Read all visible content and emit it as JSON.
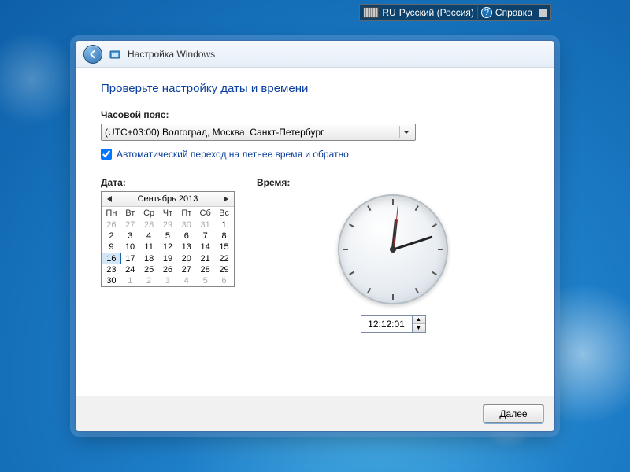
{
  "langbar": {
    "code": "RU",
    "language": "Русский (Россия)",
    "help": "Справка"
  },
  "window": {
    "title": "Настройка Windows"
  },
  "heading": "Проверьте настройку даты и времени",
  "tz": {
    "label": "Часовой пояс:",
    "selected": "(UTC+03:00) Волгоград, Москва, Санкт-Петербург"
  },
  "dst": {
    "checked": true,
    "label": "Автоматический переход на летнее время и обратно"
  },
  "date": {
    "label": "Дата:",
    "month_title": "Сентябрь 2013",
    "dow": [
      "Пн",
      "Вт",
      "Ср",
      "Чт",
      "Пт",
      "Сб",
      "Вс"
    ],
    "leading_other": [
      26,
      27,
      28,
      29,
      30,
      31
    ],
    "days": 30,
    "selected": 16,
    "trailing_other": [
      1,
      2,
      3,
      4,
      5,
      6
    ]
  },
  "time": {
    "label": "Время:",
    "value": "12:12:01"
  },
  "footer": {
    "next": "Далее"
  }
}
